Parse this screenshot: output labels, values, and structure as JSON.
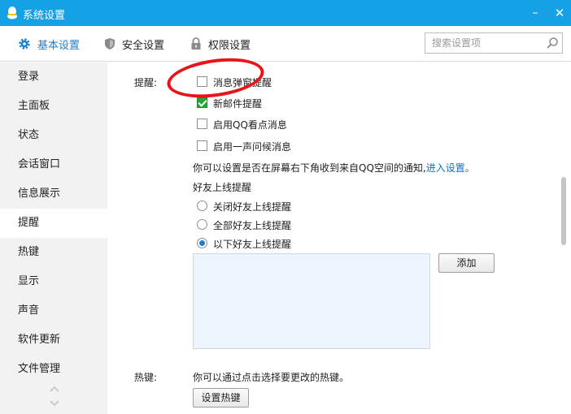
{
  "window": {
    "title": "系统设置",
    "minimize": "–",
    "close": "✕"
  },
  "tabs": [
    {
      "label": "基本设置",
      "icon": "gear-icon",
      "active": true
    },
    {
      "label": "安全设置",
      "icon": "shield-icon"
    },
    {
      "label": "权限设置",
      "icon": "lock-icon"
    }
  ],
  "search": {
    "placeholder": "搜索设置项",
    "value": ""
  },
  "sidebar": {
    "items": [
      {
        "label": "登录"
      },
      {
        "label": "主面板"
      },
      {
        "label": "状态"
      },
      {
        "label": "会话窗口"
      },
      {
        "label": "信息展示"
      },
      {
        "label": "提醒",
        "active": true
      },
      {
        "label": "热键"
      },
      {
        "label": "显示"
      },
      {
        "label": "声音"
      },
      {
        "label": "软件更新"
      },
      {
        "label": "文件管理"
      }
    ]
  },
  "reminder": {
    "section_label": "提醒:",
    "options": [
      {
        "label": "消息弹窗提醒",
        "checked": false
      },
      {
        "label": "新邮件提醒",
        "checked": true
      },
      {
        "label": "启用QQ看点消息",
        "checked": false
      },
      {
        "label": "启用一声问候消息",
        "checked": false
      }
    ],
    "notice_text": "你可以设置是否在屏幕右下角收到来自QQ空间的通知,",
    "notice_link": "进入设置。",
    "friend_online": {
      "title": "好友上线提醒",
      "options": [
        {
          "label": "关闭好友上线提醒",
          "selected": false
        },
        {
          "label": "全部好友上线提醒",
          "selected": false
        },
        {
          "label": "以下好友上线提醒",
          "selected": true
        }
      ],
      "add_button": "添加"
    }
  },
  "hotkey": {
    "section_label": "热键:",
    "description": "你可以通过点击选择要更改的热键。",
    "button": "设置热键"
  },
  "colors": {
    "titlebar": "#16a0e6",
    "accent": "#1a7fd0",
    "annotation": "#e8141a"
  }
}
